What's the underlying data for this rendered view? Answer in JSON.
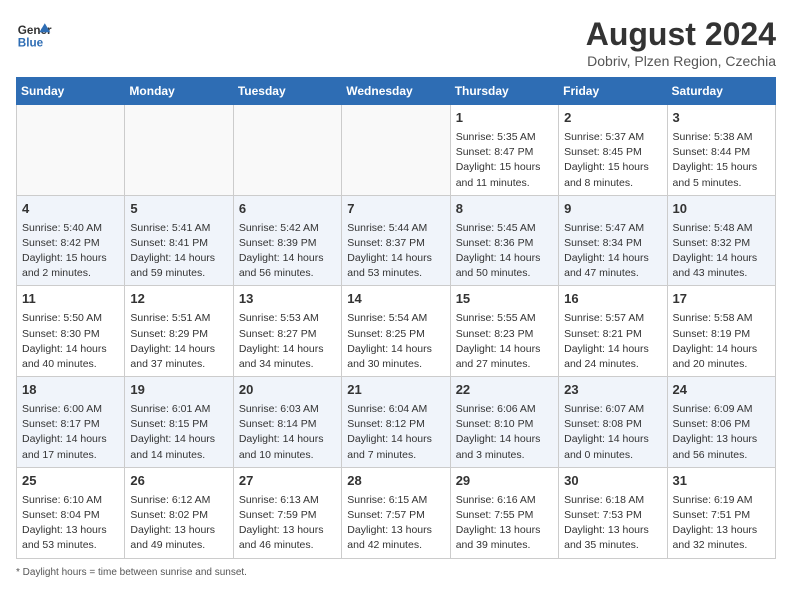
{
  "header": {
    "logo_line1": "General",
    "logo_line2": "Blue",
    "month_year": "August 2024",
    "location": "Dobriv, Plzen Region, Czechia"
  },
  "days_of_week": [
    "Sunday",
    "Monday",
    "Tuesday",
    "Wednesday",
    "Thursday",
    "Friday",
    "Saturday"
  ],
  "weeks": [
    [
      {
        "day": "",
        "empty": true
      },
      {
        "day": "",
        "empty": true
      },
      {
        "day": "",
        "empty": true
      },
      {
        "day": "",
        "empty": true
      },
      {
        "day": "1",
        "sunrise": "5:35 AM",
        "sunset": "8:47 PM",
        "daylight": "15 hours and 11 minutes."
      },
      {
        "day": "2",
        "sunrise": "5:37 AM",
        "sunset": "8:45 PM",
        "daylight": "15 hours and 8 minutes."
      },
      {
        "day": "3",
        "sunrise": "5:38 AM",
        "sunset": "8:44 PM",
        "daylight": "15 hours and 5 minutes."
      }
    ],
    [
      {
        "day": "4",
        "sunrise": "5:40 AM",
        "sunset": "8:42 PM",
        "daylight": "15 hours and 2 minutes."
      },
      {
        "day": "5",
        "sunrise": "5:41 AM",
        "sunset": "8:41 PM",
        "daylight": "14 hours and 59 minutes."
      },
      {
        "day": "6",
        "sunrise": "5:42 AM",
        "sunset": "8:39 PM",
        "daylight": "14 hours and 56 minutes."
      },
      {
        "day": "7",
        "sunrise": "5:44 AM",
        "sunset": "8:37 PM",
        "daylight": "14 hours and 53 minutes."
      },
      {
        "day": "8",
        "sunrise": "5:45 AM",
        "sunset": "8:36 PM",
        "daylight": "14 hours and 50 minutes."
      },
      {
        "day": "9",
        "sunrise": "5:47 AM",
        "sunset": "8:34 PM",
        "daylight": "14 hours and 47 minutes."
      },
      {
        "day": "10",
        "sunrise": "5:48 AM",
        "sunset": "8:32 PM",
        "daylight": "14 hours and 43 minutes."
      }
    ],
    [
      {
        "day": "11",
        "sunrise": "5:50 AM",
        "sunset": "8:30 PM",
        "daylight": "14 hours and 40 minutes."
      },
      {
        "day": "12",
        "sunrise": "5:51 AM",
        "sunset": "8:29 PM",
        "daylight": "14 hours and 37 minutes."
      },
      {
        "day": "13",
        "sunrise": "5:53 AM",
        "sunset": "8:27 PM",
        "daylight": "14 hours and 34 minutes."
      },
      {
        "day": "14",
        "sunrise": "5:54 AM",
        "sunset": "8:25 PM",
        "daylight": "14 hours and 30 minutes."
      },
      {
        "day": "15",
        "sunrise": "5:55 AM",
        "sunset": "8:23 PM",
        "daylight": "14 hours and 27 minutes."
      },
      {
        "day": "16",
        "sunrise": "5:57 AM",
        "sunset": "8:21 PM",
        "daylight": "14 hours and 24 minutes."
      },
      {
        "day": "17",
        "sunrise": "5:58 AM",
        "sunset": "8:19 PM",
        "daylight": "14 hours and 20 minutes."
      }
    ],
    [
      {
        "day": "18",
        "sunrise": "6:00 AM",
        "sunset": "8:17 PM",
        "daylight": "14 hours and 17 minutes."
      },
      {
        "day": "19",
        "sunrise": "6:01 AM",
        "sunset": "8:15 PM",
        "daylight": "14 hours and 14 minutes."
      },
      {
        "day": "20",
        "sunrise": "6:03 AM",
        "sunset": "8:14 PM",
        "daylight": "14 hours and 10 minutes."
      },
      {
        "day": "21",
        "sunrise": "6:04 AM",
        "sunset": "8:12 PM",
        "daylight": "14 hours and 7 minutes."
      },
      {
        "day": "22",
        "sunrise": "6:06 AM",
        "sunset": "8:10 PM",
        "daylight": "14 hours and 3 minutes."
      },
      {
        "day": "23",
        "sunrise": "6:07 AM",
        "sunset": "8:08 PM",
        "daylight": "14 hours and 0 minutes."
      },
      {
        "day": "24",
        "sunrise": "6:09 AM",
        "sunset": "8:06 PM",
        "daylight": "13 hours and 56 minutes."
      }
    ],
    [
      {
        "day": "25",
        "sunrise": "6:10 AM",
        "sunset": "8:04 PM",
        "daylight": "13 hours and 53 minutes."
      },
      {
        "day": "26",
        "sunrise": "6:12 AM",
        "sunset": "8:02 PM",
        "daylight": "13 hours and 49 minutes."
      },
      {
        "day": "27",
        "sunrise": "6:13 AM",
        "sunset": "7:59 PM",
        "daylight": "13 hours and 46 minutes."
      },
      {
        "day": "28",
        "sunrise": "6:15 AM",
        "sunset": "7:57 PM",
        "daylight": "13 hours and 42 minutes."
      },
      {
        "day": "29",
        "sunrise": "6:16 AM",
        "sunset": "7:55 PM",
        "daylight": "13 hours and 39 minutes."
      },
      {
        "day": "30",
        "sunrise": "6:18 AM",
        "sunset": "7:53 PM",
        "daylight": "13 hours and 35 minutes."
      },
      {
        "day": "31",
        "sunrise": "6:19 AM",
        "sunset": "7:51 PM",
        "daylight": "13 hours and 32 minutes."
      }
    ]
  ],
  "footer_note": "Daylight hours"
}
